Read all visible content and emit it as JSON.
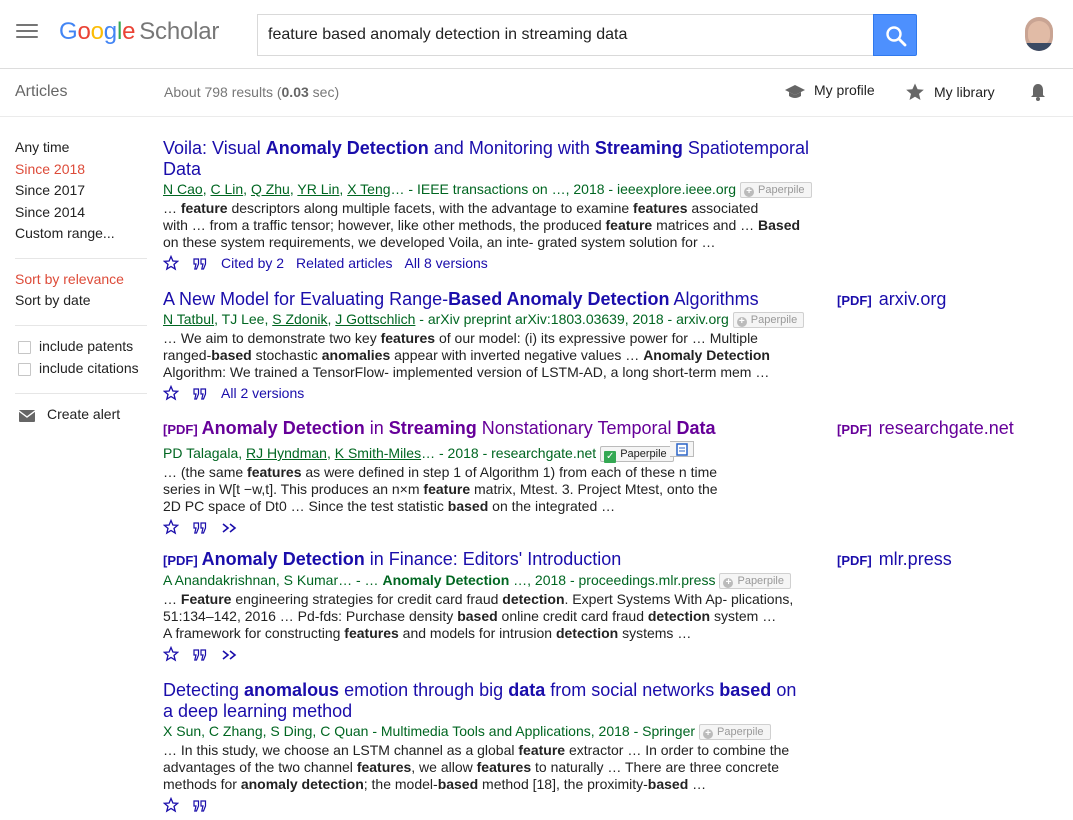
{
  "header": {
    "logo_letters": [
      "G",
      "o",
      "o",
      "g",
      "l",
      "e"
    ],
    "logo_suffix": "Scholar",
    "search_value": "feature based anomaly detection in streaming data",
    "icons": {
      "menu": "hamburger-menu-icon",
      "search": "search-icon",
      "avatar": "user-avatar"
    },
    "colors": {
      "search_button": "#4d90fe"
    }
  },
  "subbar": {
    "section_label": "Articles",
    "stats_prefix": "About 798 results (",
    "stats_time": "0.03",
    "stats_suffix": " sec)",
    "my_profile": "My profile",
    "my_library": "My library",
    "icons": {
      "profile": "graduation-cap-icon",
      "library": "star-icon",
      "alerts": "bell-icon"
    }
  },
  "sidebar": {
    "time_filters": [
      "Any time",
      "Since 2018",
      "Since 2017",
      "Since 2014",
      "Custom range..."
    ],
    "selected_time_index": 1,
    "sort_options": [
      "Sort by relevance",
      "Sort by date"
    ],
    "selected_sort_index": 0,
    "include_patents": "include patents",
    "include_citations": "include citations",
    "create_alert": "Create alert",
    "colors": {
      "selected": "#dd4b39"
    }
  },
  "results": [
    {
      "title": [
        "Voila: Visual ",
        "Anomaly Detection",
        " and Monitoring with ",
        "Streaming",
        " Spatiotemporal",
        "Data"
      ],
      "authors": [
        "N Cao",
        "C Lin",
        "Q Zhu",
        "YR Lin",
        "X Teng"
      ],
      "source": "… - IEEE transactions on …, 2018 - ieeexplore.ieee.org",
      "paperpile": "Paperpile",
      "snippet": [
        "… ",
        "feature",
        " descriptors along multiple facets, with the advantage to examine ",
        "features",
        " associated",
        "with … from a traffic tensor; however, like other methods, the produced ",
        "feature",
        " matrices and … ",
        "Based",
        "on these system requirements, we developed Voila, an inte- grated system solution for …"
      ],
      "cited_by": "Cited by 2",
      "related": "Related articles",
      "versions": "All 8 versions"
    },
    {
      "title": [
        "A New Model for Evaluating Range-",
        "Based Anomaly Detection",
        " Algorithms"
      ],
      "pdf_side_tag": "[PDF]",
      "pdf_side_host": "arxiv.org",
      "authors_plain": [
        "TJ Lee"
      ],
      "authors": [
        "N Tatbul",
        "S Zdonik",
        "J Gottschlich"
      ],
      "source": " - arXiv preprint arXiv:1803.03639, 2018 - arxiv.org",
      "paperpile": "Paperpile",
      "snippet": [
        "… We aim to demonstrate two key ",
        "features",
        " of our model: (i) its expressive power for … Multiple",
        "ranged-",
        "based",
        " stochastic ",
        "anomalies",
        " appear with inverted negative values … ",
        "Anomaly Detection",
        "Algorithm: We trained a TensorFlow- implemented version of LSTM-AD, a long short-term mem …"
      ],
      "versions": "All 2 versions"
    },
    {
      "pdf_tag": "[PDF]",
      "title": [
        "Anomaly Detection",
        " in ",
        "Streaming",
        " Nonstationary Temporal ",
        "Data"
      ],
      "pdf_side_tag": "[PDF]",
      "pdf_side_host": "researchgate.net",
      "authors_plain": [
        "PD Talagala"
      ],
      "authors": [
        "RJ Hyndman",
        "K Smith-Miles"
      ],
      "source": "… - 2018 - researchgate.net",
      "paperpile": "Paperpile",
      "snippet": [
        "… (the same ",
        "features",
        " as were defined in step 1 of Algorithm 1) from each of these n time",
        "series in W[t −w,t]. This produces an n×m ",
        "feature",
        " matrix, Mtest. 3. Project Mtest, onto the",
        "2D PC space of Dt0 … Since the test statistic ",
        "based",
        " on the integrated …"
      ]
    },
    {
      "pdf_tag": "[PDF]",
      "title": [
        "Anomaly Detection",
        " in Finance: Editors' Introduction"
      ],
      "pdf_side_tag": "[PDF]",
      "pdf_side_host": "mlr.press",
      "authors_plain_text": "A Anandakrishnan, S Kumar… - … ",
      "meta_bold": "Anomaly Detection",
      "source": " …, 2018 - proceedings.mlr.press",
      "paperpile": "Paperpile",
      "snippet": [
        "… ",
        "Feature",
        " engineering strategies for credit card fraud ",
        "detection",
        ". Expert Systems With Ap- plications,",
        "51:134–142, 2016 … Pd-fds: Purchase density ",
        "based",
        " online credit card fraud ",
        "detection",
        " system …",
        "A framework for constructing ",
        "features",
        " and models for intrusion ",
        "detection",
        " systems …"
      ]
    },
    {
      "title": [
        "Detecting ",
        "anomalous",
        " emotion through big ",
        "data",
        " from social networks ",
        "based",
        " on",
        "a deep learning method"
      ],
      "authors_plain_text": "X Sun, C Zhang, S Ding, C Quan",
      "source": " - Multimedia Tools and Applications, 2018 - Springer",
      "paperpile": "Paperpile",
      "snippet": [
        "… In this study, we choose an LSTM channel as a global ",
        "feature",
        " extractor … In order to combine the",
        "advantages of the two channel ",
        "features",
        ", we allow ",
        "features",
        " to naturally … There are three concrete",
        "methods for ",
        "anomaly detection",
        "; the model-",
        "based",
        " method [18], the proximity-",
        "based",
        " …"
      ]
    }
  ],
  "colors": {
    "link": "#1a0dab",
    "visited": "#660099",
    "meta_green": "#006621"
  }
}
